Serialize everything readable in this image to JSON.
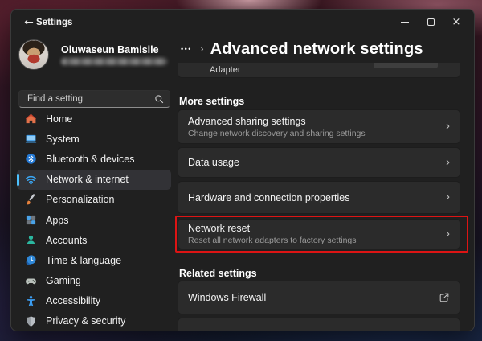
{
  "titlebar": {
    "app_title": "Settings"
  },
  "icons": {
    "back": "←",
    "close": "×",
    "chevron_right": "›"
  },
  "sidebar": {
    "user": {
      "name": "Oluwaseun Bamisile",
      "email_obscured": true
    },
    "search": {
      "placeholder": "Find a setting"
    },
    "nav": [
      {
        "label": "Home",
        "icon": "home-icon"
      },
      {
        "label": "System",
        "icon": "system-icon"
      },
      {
        "label": "Bluetooth & devices",
        "icon": "bluetooth-icon"
      },
      {
        "label": "Network & internet",
        "icon": "network-icon",
        "selected": true
      },
      {
        "label": "Personalization",
        "icon": "personalization-icon"
      },
      {
        "label": "Apps",
        "icon": "apps-icon"
      },
      {
        "label": "Accounts",
        "icon": "accounts-icon"
      },
      {
        "label": "Time & language",
        "icon": "time-language-icon"
      },
      {
        "label": "Gaming",
        "icon": "gaming-icon"
      },
      {
        "label": "Accessibility",
        "icon": "accessibility-icon"
      },
      {
        "label": "Privacy & security",
        "icon": "privacy-security-icon"
      }
    ]
  },
  "main": {
    "breadcrumb": {
      "ellipsis": "•••",
      "separator": "›",
      "title": "Advanced network settings"
    },
    "adapter_row": {
      "label": "Adapter"
    },
    "sections": {
      "more": "More settings",
      "related": "Related settings"
    },
    "cards": [
      {
        "title": "Advanced sharing settings",
        "subtitle": "Change network discovery and sharing settings",
        "trailing": "chevron"
      },
      {
        "title": "Data usage",
        "trailing": "chevron"
      },
      {
        "title": "Hardware and connection properties",
        "trailing": "chevron"
      },
      {
        "title": "Network reset",
        "subtitle": "Reset all network adapters to factory settings",
        "trailing": "chevron",
        "highlighted": true
      },
      {
        "title": "Windows Firewall",
        "trailing": "external-link"
      }
    ]
  },
  "colors": {
    "accent": "#4cc2ff",
    "highlight_red": "#dd1414",
    "window_bg": "#202020",
    "card_bg": "#2b2b2b"
  }
}
